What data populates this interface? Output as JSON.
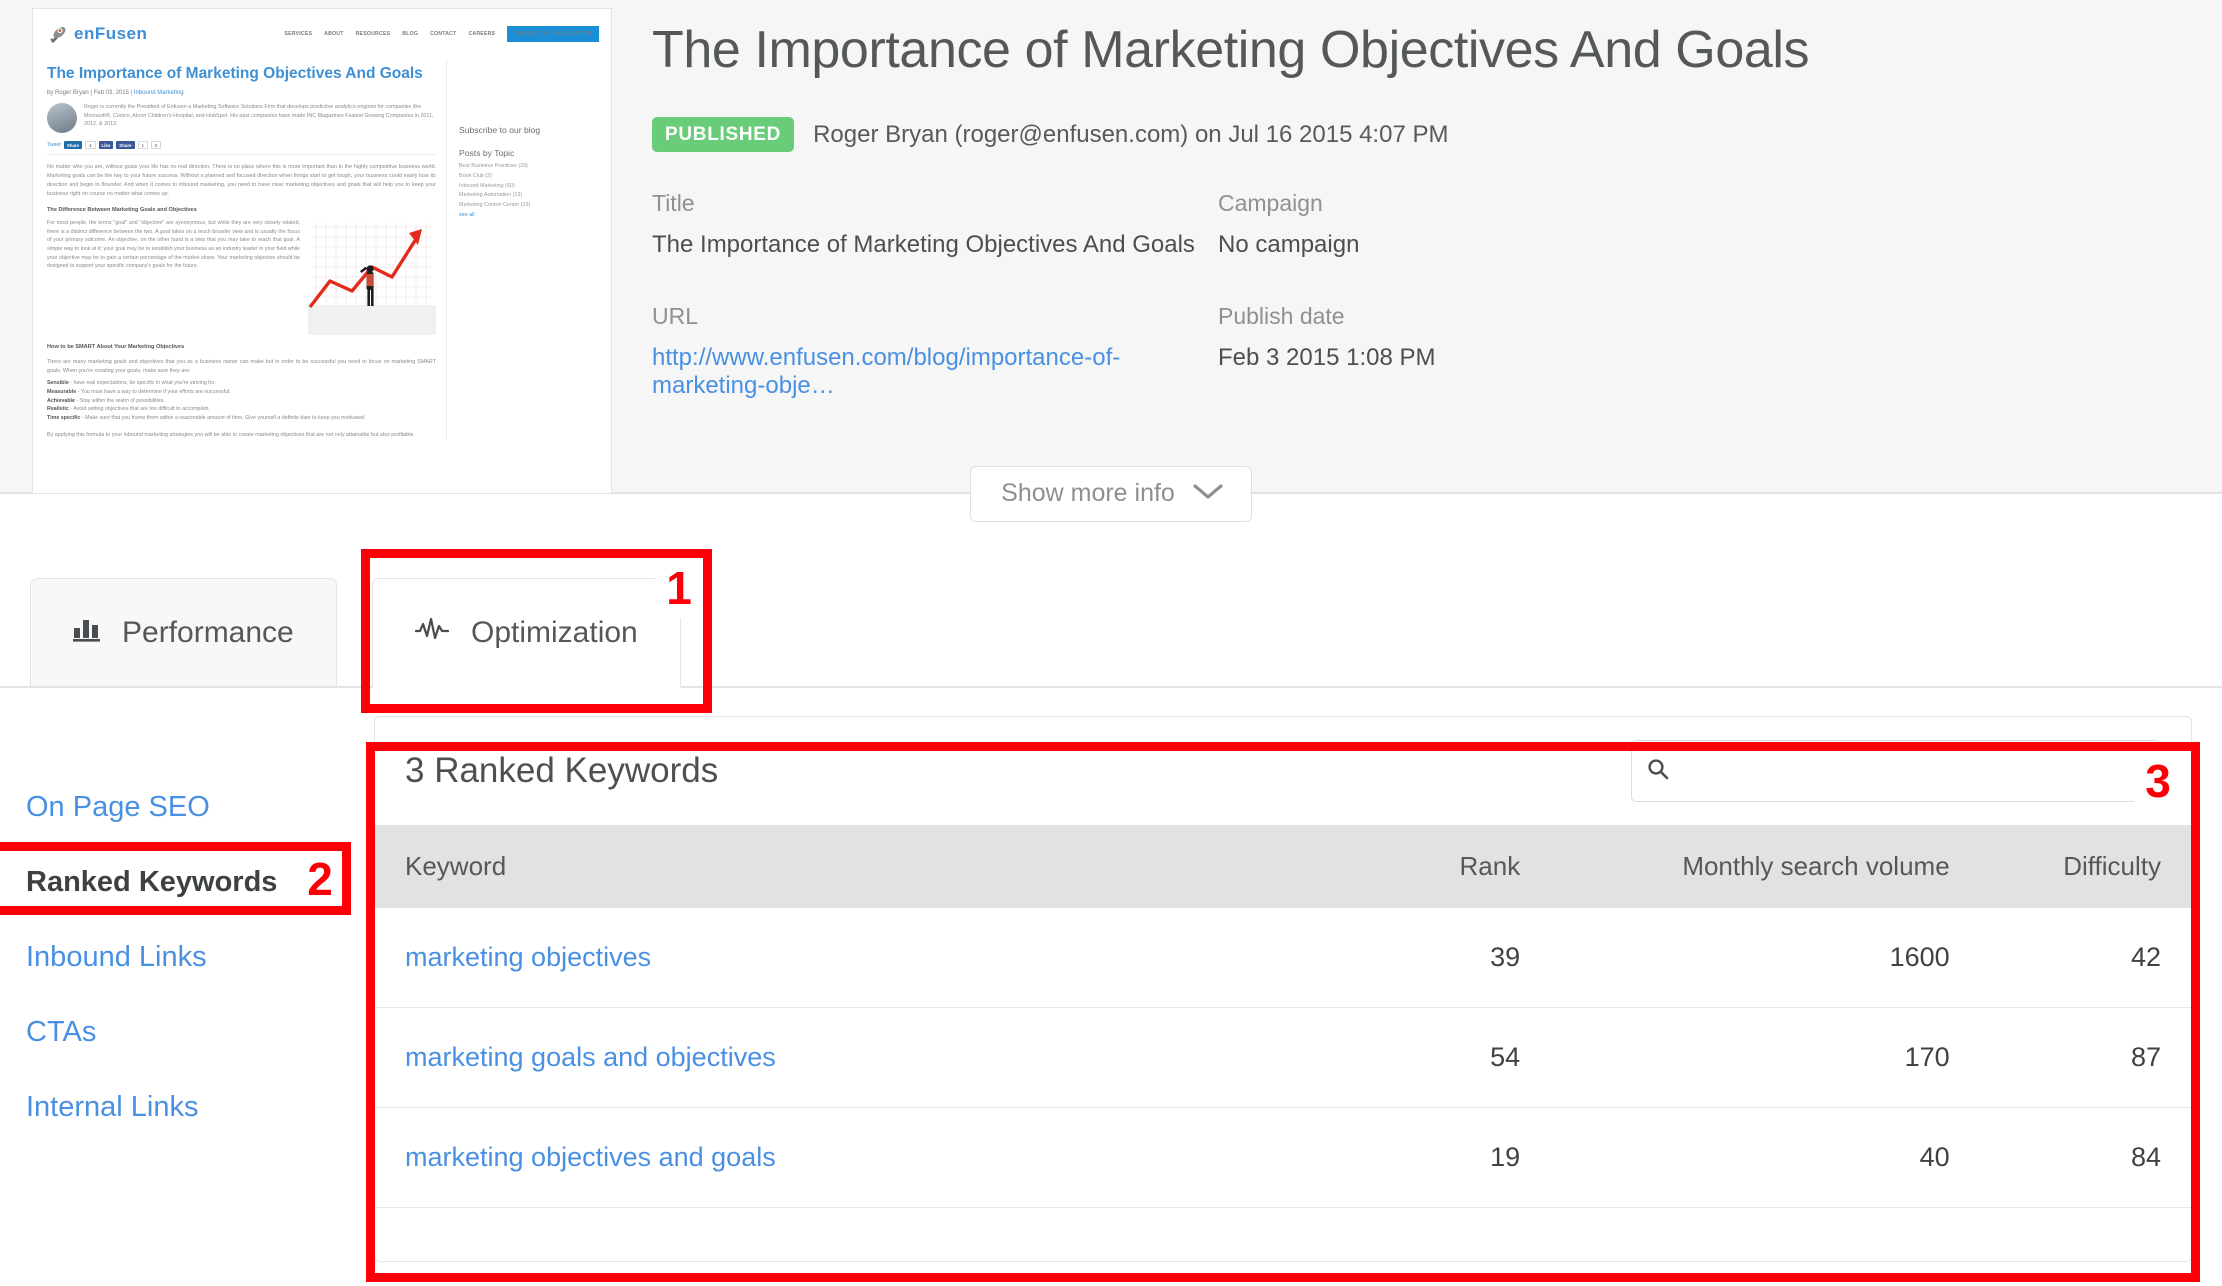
{
  "header": {
    "doc_title": "The Importance of Marketing Objectives And Goals",
    "status_badge": "PUBLISHED",
    "byline": "Roger Bryan (roger@enfusen.com) on Jul 16 2015 4:07 PM",
    "badge_color": "#68cc79",
    "meta": {
      "title_label": "Title",
      "title_value": "The Importance of Marketing Objectives And Goals",
      "campaign_label": "Campaign",
      "campaign_value": "No campaign",
      "url_label": "URL",
      "url_value": "http://www.enfusen.com/blog/importance-of-marketing-obje…",
      "publish_label": "Publish date",
      "publish_value": "Feb 3 2015 1:08 PM"
    },
    "show_more_label": "Show more info",
    "show_more_icon": "chevron-down-icon"
  },
  "thumbnail": {
    "brand": "enFusen",
    "logo_icon": "rocket-icon",
    "nav": [
      "SERVICES",
      "ABOUT",
      "RESOURCES",
      "BLOG",
      "CONTACT",
      "CAREERS"
    ],
    "cta": "REQUEST A CONSULTATION",
    "post_title": "The Importance of Marketing Objectives And Goals",
    "post_meta_author": "by Roger Bryan | Feb 03, 2015 | ",
    "post_meta_category": "Inbound Marketing",
    "author_bio": "Roger is currently the President of Enfusen a Marketing Software Solutions Firm that develops predictive analytics engines for companies like Microsoft®, Costco, Akron Children's Hospital, and HubSpot. His past companies have made INC Magazines Fastest Growing Companies in 2011, 2012, & 2013.",
    "share": [
      "Tweet",
      "Share",
      "Like",
      "Share"
    ],
    "paragraph1": "No matter who you are, without goals your life has no real direction. There is no place where this is more important than in the highly competitive business world. Marketing goals can be the key to your future success. Without a planned and focused direction when things start to get tough, your business could easily lose its direction and begin to flounder. And when it comes to inbound marketing, you need to have clear marketing objectives and goals that will help you to keep your business right on course no matter what comes up.",
    "heading1": "The Difference Between Marketing Goals and Objectives",
    "paragraph2": "For most people, the terms \"goal\" and \"objective\" are synonymous, but while they are very closely related, there is a distinct difference between the two. A goal takes on a much broader view and is usually the focus of your primary outcome. An objective, on the other hand is a step that you may take to reach that goal. A simple way to look at it: your goal may be to establish your business as an industry leader in your field while your objective may be to gain a certain percentage of the market share. Your marketing objective should be designed to support your specific company's goals for the future.",
    "heading2": "How to be SMART About Your Marketing Objectives",
    "paragraph3": "There are many marketing goals and objectives that you as a business owner can make but in order to be successful you need to focus on marketing SMART goals. When you're creating your goals, make sure they are:",
    "smart_items": [
      {
        "term": "Sensible",
        "desc": " - have real expectations, be specific in what you're striving for."
      },
      {
        "term": "Measurable",
        "desc": " - You must have a way to determine if your efforts are successful."
      },
      {
        "term": "Achievable",
        "desc": " - Stay within the realm of possibilities."
      },
      {
        "term": "Realistic",
        "desc": " - Avoid setting objectives that are too difficult to accomplish."
      },
      {
        "term": "Time specific",
        "desc": " - Make sure that you frame them within a reasonable amount of time. Give yourself a definite date to keep you motivated."
      }
    ],
    "paragraph4": "By applying this formula to your inbound marketing strategies you will be able to create marketing objectives that are not only attainable but also profitable.",
    "sidebar_subscribe": "Subscribe to our blog",
    "sidebar_topics_title": "Posts by Topic",
    "sidebar_topics": [
      "Best Business Practices (33)",
      "Book Club (2)",
      "Inbound Marketing (60)",
      "Marketing Automation (13)",
      "Marketing Control Center (23)"
    ],
    "sidebar_see_all": "see all"
  },
  "tabs": [
    {
      "label": "Performance",
      "icon": "bar-chart-icon",
      "active": false
    },
    {
      "label": "Optimization",
      "icon": "activity-pulse-icon",
      "active": true
    }
  ],
  "sidenav": [
    {
      "label": "On Page SEO",
      "active": false
    },
    {
      "label": "Ranked Keywords",
      "active": true
    },
    {
      "label": "Inbound Links",
      "active": false
    },
    {
      "label": "CTAs",
      "active": false
    },
    {
      "label": "Internal Links",
      "active": false
    }
  ],
  "panel": {
    "title": "3 Ranked Keywords",
    "search": {
      "value": "",
      "placeholder": "",
      "icon": "search-icon"
    },
    "columns": [
      "Keyword",
      "Rank",
      "Monthly search volume",
      "Difficulty"
    ],
    "rows": [
      {
        "keyword": "marketing objectives",
        "rank": "39",
        "volume": "1600",
        "difficulty": "42"
      },
      {
        "keyword": "marketing goals and objectives",
        "rank": "54",
        "volume": "170",
        "difficulty": "87"
      },
      {
        "keyword": "marketing objectives and goals",
        "rank": "19",
        "volume": "40",
        "difficulty": "84"
      }
    ]
  },
  "annotations": [
    {
      "number": "1",
      "target": "optimization-tab"
    },
    {
      "number": "2",
      "target": "ranked-keywords-sidenav-item"
    },
    {
      "number": "3",
      "target": "ranked-keywords-panel"
    }
  ],
  "colors": {
    "annotation": "#fb0007",
    "link": "#4a90e2",
    "published": "#68cc79"
  }
}
